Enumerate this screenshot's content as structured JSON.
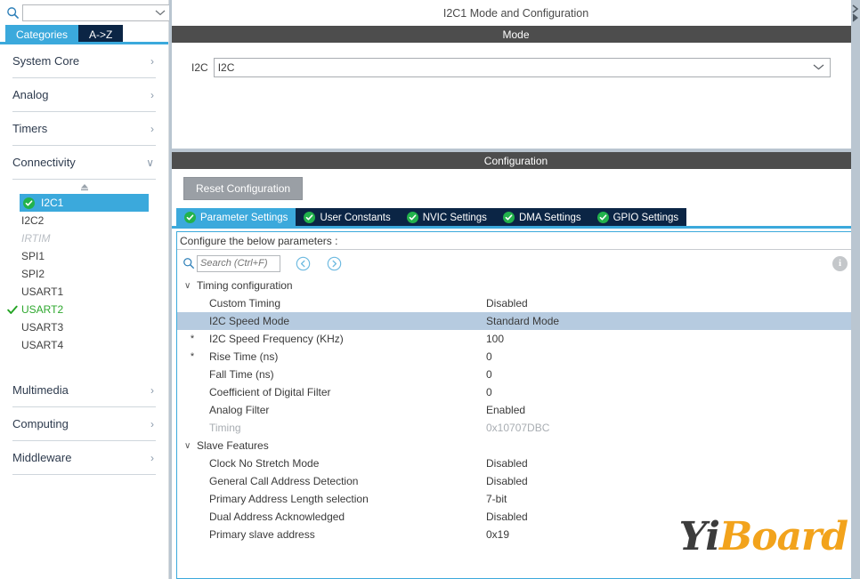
{
  "sidebar": {
    "search": {
      "value": "",
      "placeholder": ""
    },
    "gear_icon": "gear-icon",
    "tabs": [
      {
        "label": "Categories",
        "active": true
      },
      {
        "label": "A->Z",
        "active": false
      }
    ],
    "groups_top": [
      {
        "label": "System Core",
        "chevron": "›"
      },
      {
        "label": "Analog",
        "chevron": "›"
      },
      {
        "label": "Timers",
        "chevron": "›"
      },
      {
        "label": "Connectivity",
        "chevron": "∨"
      }
    ],
    "tree": [
      {
        "label": "I2C1",
        "state": "selected",
        "icon": "green-check-circle-icon"
      },
      {
        "label": "I2C2",
        "state": "normal",
        "icon": ""
      },
      {
        "label": "IRTIM",
        "state": "disabled",
        "icon": ""
      },
      {
        "label": "SPI1",
        "state": "normal",
        "icon": ""
      },
      {
        "label": "SPI2",
        "state": "normal",
        "icon": ""
      },
      {
        "label": "USART1",
        "state": "normal",
        "icon": ""
      },
      {
        "label": "USART2",
        "state": "ok",
        "icon": "green-check-icon"
      },
      {
        "label": "USART3",
        "state": "normal",
        "icon": ""
      },
      {
        "label": "USART4",
        "state": "normal",
        "icon": ""
      }
    ],
    "groups_bottom": [
      {
        "label": "Multimedia",
        "chevron": "›"
      },
      {
        "label": "Computing",
        "chevron": "›"
      },
      {
        "label": "Middleware",
        "chevron": "›"
      }
    ]
  },
  "main": {
    "title": "I2C1 Mode and Configuration",
    "mode_bar": "Mode",
    "mode": {
      "label": "I2C",
      "value": "I2C",
      "chevron": "∨"
    },
    "configuration_bar": "Configuration",
    "reset_button": "Reset Configuration",
    "tabs": [
      {
        "label": "Parameter Settings",
        "active": true
      },
      {
        "label": "User Constants",
        "active": false
      },
      {
        "label": "NVIC Settings",
        "active": false
      },
      {
        "label": "DMA Settings",
        "active": false
      },
      {
        "label": "GPIO Settings",
        "active": false
      }
    ],
    "param_hint": "Configure the below parameters :",
    "param_search": {
      "value": "",
      "placeholder": "Search (Ctrl+F)"
    },
    "nav_prev_icon": "circle-chevron-left-icon",
    "nav_next_icon": "circle-chevron-right-icon",
    "info_icon": "info-icon",
    "info_glyph": "i",
    "groups": [
      {
        "label": "Timing configuration",
        "chevron": "∨",
        "rows": [
          {
            "star": "",
            "name": "Custom Timing",
            "value": "Disabled",
            "selected": false,
            "dim": false
          },
          {
            "star": "",
            "name": "I2C Speed Mode",
            "value": "Standard Mode",
            "selected": true,
            "dim": false
          },
          {
            "star": "*",
            "name": "I2C Speed Frequency (KHz)",
            "value": "100",
            "selected": false,
            "dim": false
          },
          {
            "star": "*",
            "name": "Rise Time (ns)",
            "value": "0",
            "selected": false,
            "dim": false
          },
          {
            "star": "",
            "name": "Fall Time (ns)",
            "value": "0",
            "selected": false,
            "dim": false
          },
          {
            "star": "",
            "name": "Coefficient of Digital Filter",
            "value": "0",
            "selected": false,
            "dim": false
          },
          {
            "star": "",
            "name": "Analog Filter",
            "value": "Enabled",
            "selected": false,
            "dim": false
          },
          {
            "star": "",
            "name": "Timing",
            "value": "0x10707DBC",
            "selected": false,
            "dim": true
          }
        ]
      },
      {
        "label": "Slave Features",
        "chevron": "∨",
        "rows": [
          {
            "star": "",
            "name": "Clock No Stretch Mode",
            "value": "Disabled",
            "selected": false,
            "dim": false
          },
          {
            "star": "",
            "name": "General Call Address Detection",
            "value": "Disabled",
            "selected": false,
            "dim": false
          },
          {
            "star": "",
            "name": "Primary Address Length selection",
            "value": "7-bit",
            "selected": false,
            "dim": false
          },
          {
            "star": "",
            "name": "Dual Address Acknowledged",
            "value": "Disabled",
            "selected": false,
            "dim": false
          },
          {
            "star": "",
            "name": "Primary slave address",
            "value": "0x19",
            "selected": false,
            "dim": false
          }
        ]
      }
    ]
  },
  "watermark": {
    "part1": "Yi",
    "part2": "Board"
  },
  "colors": {
    "accent_blue": "#3ba9dc",
    "tab_navy": "#0b2545",
    "bar_dark": "#4d4d4d",
    "row_selected": "#b6cbe0",
    "check_green": "#22b24c",
    "watermark_orange": "#f2a31c"
  }
}
